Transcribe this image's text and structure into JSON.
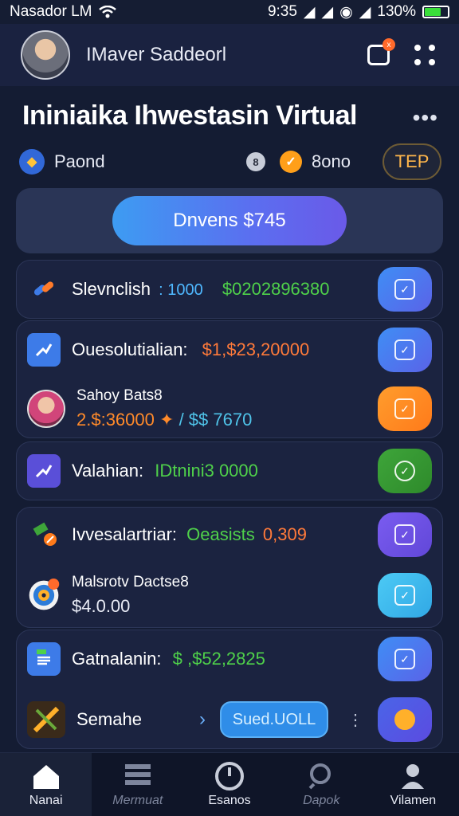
{
  "status_bar": {
    "carrier": "Nasador LM",
    "time": "9:35",
    "battery_percent": "130%"
  },
  "header": {
    "user_name": "IMaver Saddeorl",
    "notification_badge": "x"
  },
  "page": {
    "title": "Ininiaika Ihwestasin Virtual",
    "more_label": "•••"
  },
  "summary": {
    "left_label": "Paond",
    "left_icon_glyph": "◆",
    "mid_icon_glyph": "8",
    "amount_icon_glyph": "✓",
    "amount": "8ono",
    "tep_label": "TEP"
  },
  "balance": {
    "button_label": "Dnvens $745"
  },
  "items": [
    {
      "label": "Slevnclish",
      "value1": ": 1000",
      "value2": "$0202896380",
      "icon": "link-icon",
      "action": "blue"
    },
    {
      "label": "Ouesolutialian:",
      "value1": "$1,$23,20000",
      "icon": "chart-icon",
      "action": "blue"
    },
    {
      "top": "Sahoy Bats8",
      "bottom1": "2.$:36000",
      "bottom2": "/ $$ 7670",
      "icon": "profile-icon",
      "action": "orange"
    },
    {
      "label": "Valahian:",
      "value1": "IDtnini3 0000",
      "icon": "chart-icon",
      "action": "green"
    },
    {
      "label": "Ivvesalartriar:",
      "value1": "Oeasists",
      "value2": "0,309",
      "icon": "pencil-icon",
      "action": "purple"
    },
    {
      "top": "Malsrotv Dactse8",
      "bottom1": "$4.0.00",
      "icon": "disc-icon",
      "action": "cyan"
    },
    {
      "label": "Gatnalanin:",
      "value1": "$ ,$52,2825",
      "icon": "document-icon",
      "action": "blue"
    },
    {
      "label": "Semahe",
      "pill": "Sued.UOLL",
      "icon": "tools-icon",
      "action": "indigo"
    }
  ],
  "tabs": [
    {
      "label": "Nanai",
      "icon": "home-icon"
    },
    {
      "label": "Mermuat",
      "icon": "list-icon"
    },
    {
      "label": "Esanos",
      "icon": "gauge-icon"
    },
    {
      "label": "Dapok",
      "icon": "search-icon"
    },
    {
      "label": "Vilamen",
      "icon": "user-icon"
    }
  ],
  "colors": {
    "background": "#141c33",
    "green_value": "#4fd14a",
    "orange_value": "#ff7a3a",
    "cyan_value": "#4fc3e8"
  }
}
